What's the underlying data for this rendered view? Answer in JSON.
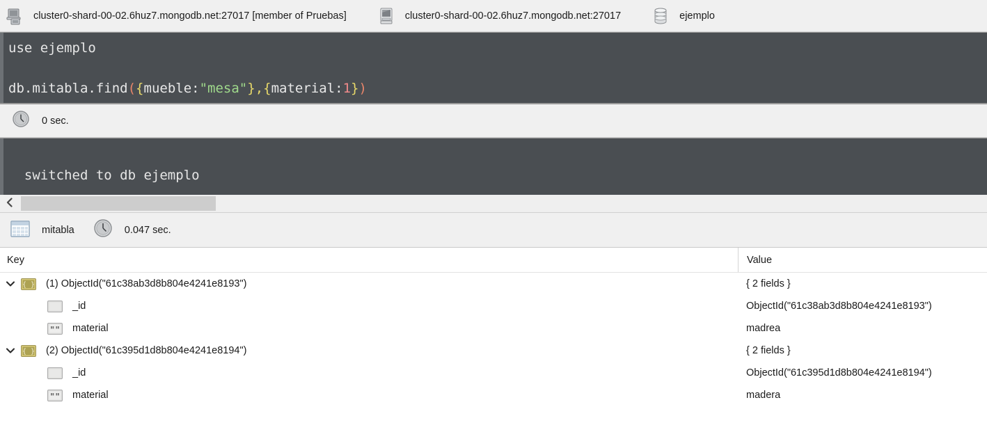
{
  "connection_bar": {
    "items": [
      {
        "icon": "server-icon",
        "label": "cluster0-shard-00-02.6huz7.mongodb.net:27017 [member of Pruebas]"
      },
      {
        "icon": "monitor-icon",
        "label": "cluster0-shard-00-02.6huz7.mongodb.net:27017"
      },
      {
        "icon": "database-icon",
        "label": "ejemplo"
      }
    ]
  },
  "editor": {
    "line1": "use ejemplo",
    "line2_tokens": {
      "prefix": "db.mitabla.find",
      "paren_open": "(",
      "brace_open": "{",
      "field1": "mueble",
      "colon1": ":",
      "string1": "\"mesa\"",
      "brace_close1": "}",
      "comma": ",",
      "brace_open2": "{",
      "field2": "material",
      "colon2": ":",
      "number": "1",
      "brace_close2": "}",
      "paren_close": ")"
    },
    "full_line2": "db.mitabla.find({mueble:\"mesa\"},{material:1})",
    "colors": {
      "background": "#4a4e52",
      "plain": "#e8e8e8",
      "string": "#9fd98b",
      "brace": "#e8d96a",
      "paren": "#e8856a",
      "number": "#f08a8a"
    }
  },
  "timing": {
    "icon": "clock-icon",
    "text": "0 sec."
  },
  "console": {
    "output": "switched to db ejemplo"
  },
  "scrollbar": {
    "left_arrow_icon": "chevron-left-icon"
  },
  "result_toolbar": {
    "collection": {
      "icon": "table-icon",
      "label": "mitabla"
    },
    "duration": {
      "icon": "clock-icon",
      "label": "0.047 sec."
    }
  },
  "result_tree": {
    "columns": {
      "key": "Key",
      "value": "Value"
    },
    "rows": [
      {
        "level": 1,
        "expanded": true,
        "icon": "document-icon",
        "key": "(1) ObjectId(\"61c38ab3d8b804e4241e8193\")",
        "value": "{ 2 fields }"
      },
      {
        "level": 2,
        "expanded": false,
        "icon": "objectid-icon",
        "key": "_id",
        "value": "ObjectId(\"61c38ab3d8b804e4241e8193\")"
      },
      {
        "level": 2,
        "expanded": false,
        "icon": "string-icon",
        "key": "material",
        "value": "madrea"
      },
      {
        "level": 1,
        "expanded": true,
        "icon": "document-icon",
        "key": "(2) ObjectId(\"61c395d1d8b804e4241e8194\")",
        "value": "{ 2 fields }"
      },
      {
        "level": 2,
        "expanded": false,
        "icon": "objectid-icon",
        "key": "_id",
        "value": "ObjectId(\"61c395d1d8b804e4241e8194\")"
      },
      {
        "level": 2,
        "expanded": false,
        "icon": "string-icon",
        "key": "material",
        "value": "madera"
      }
    ]
  }
}
